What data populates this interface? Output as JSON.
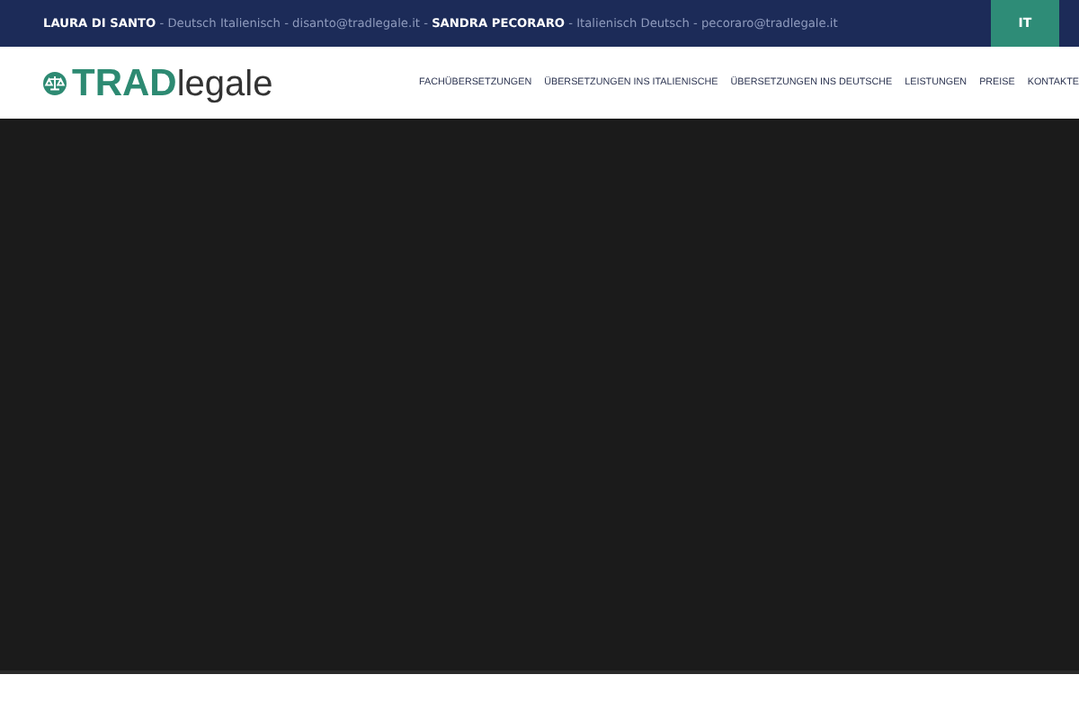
{
  "top_bar": {
    "contacts": "**LAURA DI SANTO** - Deutsch Italienisch - disanto@tradlegale.it - **SANDRA PECORARO** - Italienisch Deutsch - pecoraro@tradlegale.it",
    "language": "IT"
  },
  "header": {
    "logo_bold": "TRAD",
    "logo_light": "legale",
    "nav": [
      {
        "label": "FACHÜBERSETZUNGEN"
      },
      {
        "label": "ÜBERSETZUNGEN INS ITALIENISCHE"
      },
      {
        "label": "ÜBERSETZUNGEN INS DEUTSCHE"
      },
      {
        "label": "LEISTUNGEN"
      },
      {
        "label": "PREISE"
      },
      {
        "label": "KONTAKTE"
      }
    ]
  }
}
